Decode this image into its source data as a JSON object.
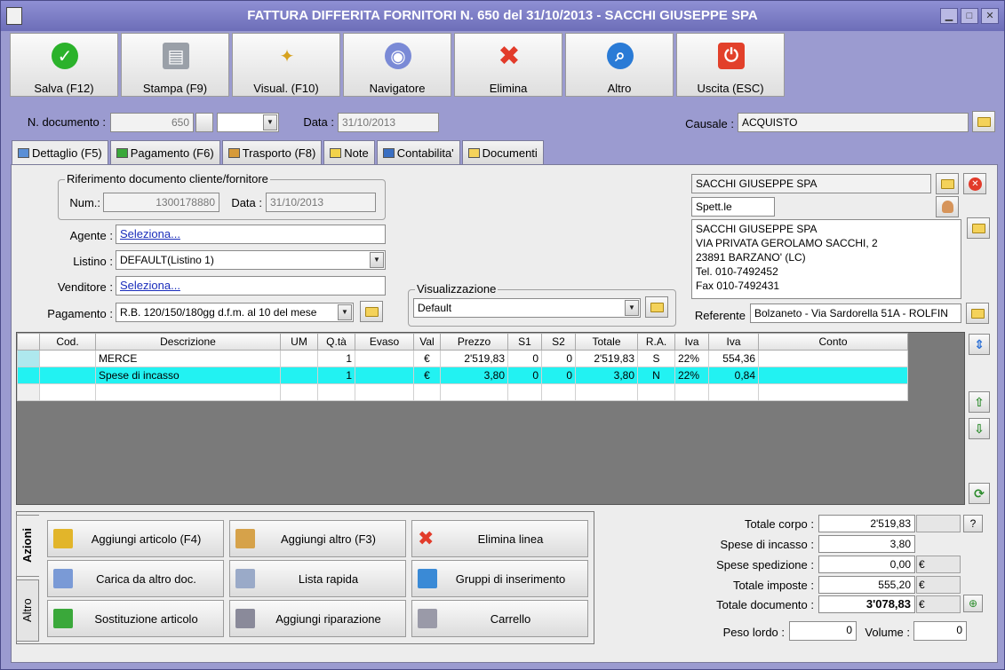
{
  "window": {
    "title": "FATTURA DIFFERITA FORNITORI N. 650 del 31/10/2013 - SACCHI GIUSEPPE SPA",
    "minimize": "▁",
    "maximize": "□",
    "close": "✕"
  },
  "toolbar": [
    {
      "label": "Salva (F12)",
      "icon": "check-icon",
      "color": "#2bb22b"
    },
    {
      "label": "Stampa (F9)",
      "icon": "printer-icon",
      "color": "#9aa0a8"
    },
    {
      "label": "Visual. (F10)",
      "icon": "magic-wand-icon",
      "color": "#d6a21f"
    },
    {
      "label": "Navigatore",
      "icon": "compass-icon",
      "color": "#7a8ad6"
    },
    {
      "label": "Elimina",
      "icon": "delete-x-icon",
      "color": "#e23b2a"
    },
    {
      "label": "Altro",
      "icon": "magnifier-icon",
      "color": "#2a7bd6"
    },
    {
      "label": "Uscita (ESC)",
      "icon": "exit-icon",
      "color": "#e2402a"
    }
  ],
  "header": {
    "num_doc_label": "N. documento :",
    "num_doc_value": "650",
    "data_label": "Data :",
    "data_value": "31/10/2013",
    "causale_label": "Causale :",
    "causale_value": "ACQUISTO"
  },
  "tabs": [
    {
      "label": "Dettaglio (F5)",
      "icon": "detail-icon",
      "color": "#5a8fd6"
    },
    {
      "label": "Pagamento (F6)",
      "icon": "payment-icon",
      "color": "#3aa83a"
    },
    {
      "label": "Trasporto (F8)",
      "icon": "truck-icon",
      "color": "#d69a3a"
    },
    {
      "label": "Note",
      "icon": "note-icon",
      "color": "#f2d24a"
    },
    {
      "label": "Contabilita'",
      "icon": "ledger-icon",
      "color": "#3a6fc2"
    },
    {
      "label": "Documenti",
      "icon": "folder-icon",
      "color": "#f4d25a"
    }
  ],
  "riferimento": {
    "title": "Riferimento documento cliente/fornitore",
    "num_label": "Num.:",
    "num_value": "1300178880",
    "data_label": "Data :",
    "data_value": "31/10/2013"
  },
  "form": {
    "agente_label": "Agente :",
    "agente_value": "Seleziona...",
    "listino_label": "Listino :",
    "listino_value": "DEFAULT(Listino 1)",
    "venditore_label": "Venditore :",
    "venditore_value": "Seleziona...",
    "pagamento_label": "Pagamento :",
    "pagamento_value": "R.B. 120/150/180gg d.f.m. al 10 del mese"
  },
  "visualizzazione": {
    "title": "Visualizzazione",
    "value": "Default"
  },
  "supplier": {
    "name": "SACCHI GIUSEPPE SPA",
    "salutation": "Spett.le",
    "address_lines": [
      "SACCHI GIUSEPPE SPA",
      "VIA PRIVATA GEROLAMO SACCHI, 2",
      "23891 BARZANO' (LC)",
      "Tel. 010-7492452",
      "Fax 010-7492431"
    ],
    "referente_label": "Referente",
    "referente_value": "Bolzaneto - Via Sardorella 51A - ROLFIN"
  },
  "grid": {
    "columns": [
      "Cod.",
      "Descrizione",
      "UM",
      "Q.tà",
      "Evaso",
      "Val",
      "Prezzo",
      "S1",
      "S2",
      "Totale",
      "R.A.",
      "Iva",
      "Iva",
      "Conto"
    ],
    "rows": [
      [
        "",
        "MERCE",
        "",
        "1",
        "",
        "€",
        "2'519,83",
        "0",
        "0",
        "2'519,83",
        "S",
        "22%",
        "554,36",
        ""
      ],
      [
        "",
        "Spese di incasso",
        "",
        "1",
        "",
        "€",
        "3,80",
        "0",
        "0",
        "3,80",
        "N",
        "22%",
        "0,84",
        ""
      ]
    ]
  },
  "actions": {
    "tab_azioni": "Azioni",
    "tab_altro": "Altro",
    "buttons": [
      {
        "label": "Aggiungi articolo (F4)",
        "icon": "box-add-icon",
        "color": "#e2b52a"
      },
      {
        "label": "Aggiungi altro (F3)",
        "icon": "grid-add-icon",
        "color": "#d6a24a"
      },
      {
        "label": "Elimina linea",
        "icon": "delete-x-icon",
        "color": "#e23b2a"
      },
      {
        "label": "Carica da altro doc.",
        "icon": "load-doc-icon",
        "color": "#7a9ad6"
      },
      {
        "label": "Lista rapida",
        "icon": "quick-list-icon",
        "color": "#9aaac8"
      },
      {
        "label": "Gruppi di inserimento",
        "icon": "group-add-icon",
        "color": "#3a8ad6"
      },
      {
        "label": "Sostituzione articolo",
        "icon": "replace-icon",
        "color": "#3aa83a"
      },
      {
        "label": "Aggiungi riparazione",
        "icon": "wrench-icon",
        "color": "#8a8a9a"
      },
      {
        "label": "Carrello",
        "icon": "cart-icon",
        "color": "#9a9aa8"
      }
    ]
  },
  "totals": {
    "totale_corpo_label": "Totale corpo :",
    "totale_corpo": "2'519,83",
    "help": "?",
    "spese_incasso_label": "Spese di incasso :",
    "spese_incasso": "3,80",
    "spese_spedizione_label": "Spese spedizione :",
    "spese_spedizione": "0,00",
    "totale_imposte_label": "Totale imposte :",
    "totale_imposte": "555,20",
    "totale_documento_label": "Totale documento :",
    "totale_documento": "3'078,83",
    "currency": "€",
    "peso_lordo_label": "Peso lordo :",
    "peso_lordo": "0",
    "volume_label": "Volume :",
    "volume": "0"
  }
}
